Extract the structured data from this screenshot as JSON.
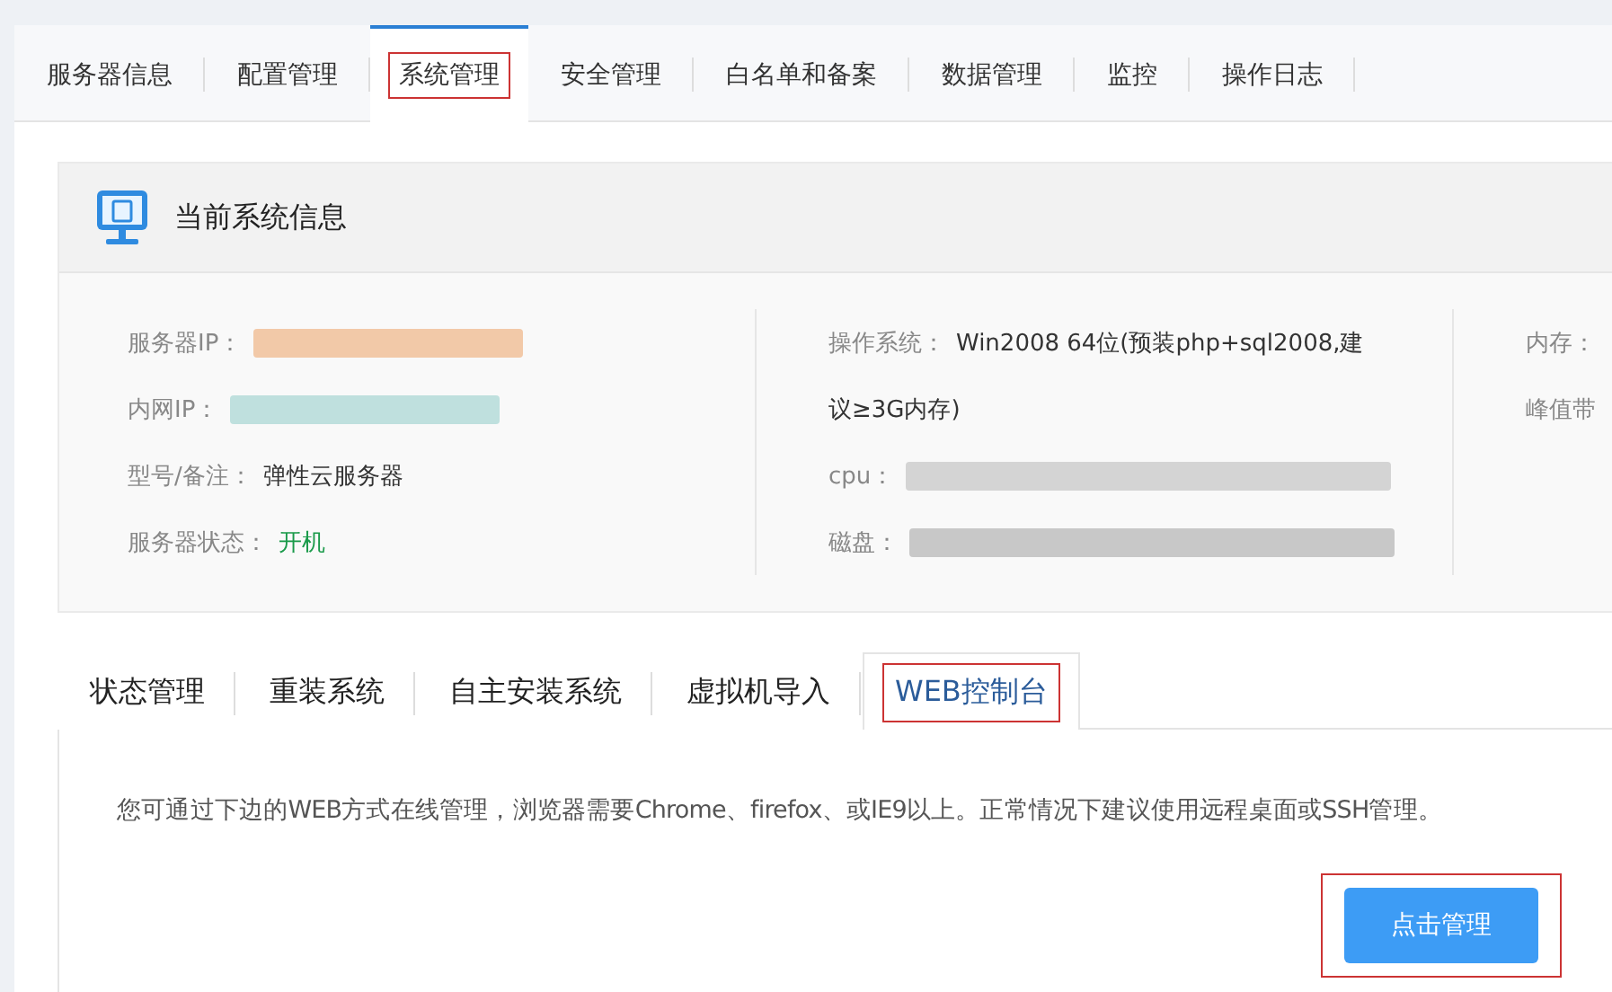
{
  "top_tabs": [
    {
      "label": "服务器信息",
      "selected": false
    },
    {
      "label": "配置管理",
      "selected": false
    },
    {
      "label": "系统管理",
      "selected": true
    },
    {
      "label": "安全管理",
      "selected": false
    },
    {
      "label": "白名单和备案",
      "selected": false
    },
    {
      "label": "数据管理",
      "selected": false
    },
    {
      "label": "监控",
      "selected": false
    },
    {
      "label": "操作日志",
      "selected": false
    }
  ],
  "info_card": {
    "title": "当前系统信息",
    "columns": [
      [
        {
          "label": "服务器IP：",
          "kind": "redacted",
          "color": "#f2c9a8"
        },
        {
          "label": "内网IP：",
          "kind": "redacted",
          "color": "#bfe0de"
        },
        {
          "label": "型号/备注：",
          "kind": "text",
          "value": "弹性云服务器"
        },
        {
          "label": "服务器状态：",
          "kind": "status",
          "value": "开机"
        }
      ],
      [
        {
          "label": "操作系统：",
          "kind": "wrap",
          "value": "Win2008 64位(预装php+sql2008,建",
          "continuation": "议≥3G内存)"
        },
        {
          "label": "cpu：",
          "kind": "redacted",
          "color": "#d4d4d4"
        },
        {
          "label": "磁盘：",
          "kind": "redacted",
          "color": "#c8c8c8"
        }
      ],
      [
        {
          "label": "内存：",
          "kind": "text"
        },
        {
          "label": "峰值带",
          "kind": "text"
        }
      ]
    ]
  },
  "sub_tabs": [
    {
      "label": "状态管理",
      "selected": false
    },
    {
      "label": "重装系统",
      "selected": false
    },
    {
      "label": "自主安装系统",
      "selected": false
    },
    {
      "label": "虚拟机导入",
      "selected": false
    },
    {
      "label": "WEB控制台",
      "selected": true
    }
  ],
  "web_console": {
    "description": "您可通过下边的WEB方式在线管理，浏览器需要Chrome、firefox、或IE9以上。正常情况下建议使用远程桌面或SSH管理。",
    "button": "点击管理"
  }
}
